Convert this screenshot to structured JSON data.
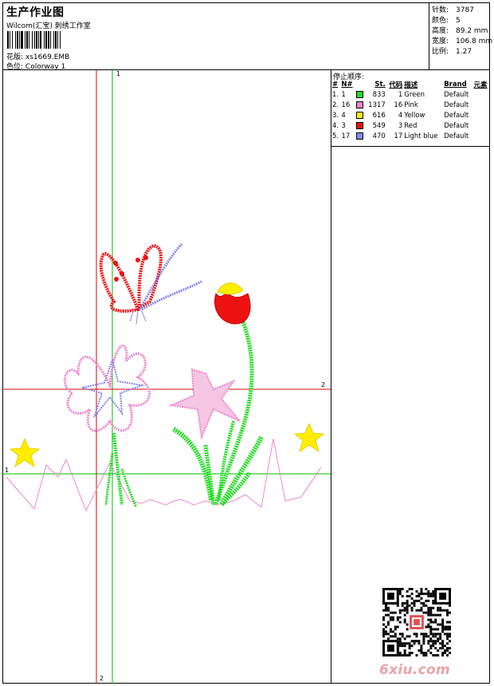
{
  "header": {
    "title": "生产作业图",
    "subtitle": "Wilcom(汇宝) 刺绣工作室",
    "design_label": "花版:",
    "design_value": "xs1669.EMB",
    "colorway_label": "色位:",
    "colorway_value": "Colorway 1"
  },
  "stats": [
    {
      "label": "针数:",
      "value": "3787"
    },
    {
      "label": "颜色:",
      "value": "5"
    },
    {
      "label": "高度:",
      "value": "89.2 mm"
    },
    {
      "label": "宽度:",
      "value": "106.8 mm"
    },
    {
      "label": "比例:",
      "value": "1.27"
    }
  ],
  "stop_sequence": {
    "title": "停止顺序:",
    "columns": [
      "#",
      "N#",
      "St.",
      "代码",
      "描述",
      "Brand",
      "元素"
    ],
    "rows": [
      {
        "seq": "1.",
        "n": "1",
        "color": "#22dd22",
        "st": "833",
        "code": "1",
        "desc": "Green",
        "brand": "Default"
      },
      {
        "seq": "2.",
        "n": "16",
        "color": "#ee88cc",
        "st": "1317",
        "code": "16",
        "desc": "Pink",
        "brand": "Default"
      },
      {
        "seq": "3.",
        "n": "4",
        "color": "#ffee00",
        "st": "616",
        "code": "4",
        "desc": "Yellow",
        "brand": "Default"
      },
      {
        "seq": "4.",
        "n": "3",
        "color": "#ee1111",
        "st": "549",
        "code": "3",
        "desc": "Red",
        "brand": "Default"
      },
      {
        "seq": "5.",
        "n": "17",
        "color": "#8888ee",
        "st": "470",
        "code": "17",
        "desc": "Light blue",
        "brand": "Default"
      }
    ]
  },
  "guides": {
    "vertical_green_top": "1",
    "horizontal_red_right": "2",
    "horizontal_green_left": "1",
    "vertical_red_bottom": "2"
  },
  "watermark": "6xiu.com",
  "colors": {
    "guide_red": "#dd0000",
    "guide_green": "#00bb00",
    "stitch_green": "#22dd22",
    "stitch_pink": "#ee88cc",
    "stitch_yellow": "#ffee00",
    "stitch_red": "#ee1111",
    "stitch_blue": "#8888ee"
  }
}
